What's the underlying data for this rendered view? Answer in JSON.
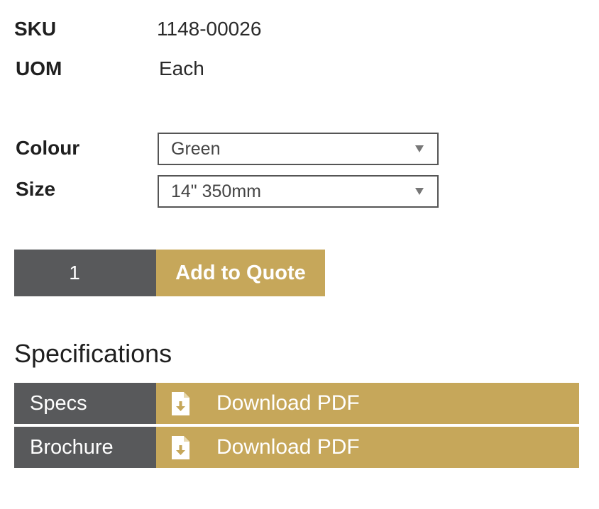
{
  "product": {
    "sku_label": "SKU",
    "sku_value": "1148-00026",
    "uom_label": "UOM",
    "uom_value": "Each"
  },
  "options": {
    "colour_label": "Colour",
    "colour_value": "Green",
    "size_label": "Size",
    "size_value": "14\" 350mm"
  },
  "quote": {
    "quantity": "1",
    "button_label": "Add to Quote"
  },
  "specifications": {
    "title": "Specifications",
    "rows": [
      {
        "label": "Specs",
        "link_label": "Download PDF"
      },
      {
        "label": "Brochure",
        "link_label": "Download PDF"
      }
    ]
  },
  "colors": {
    "accent_gold": "#c6a75a",
    "dark_grey": "#58595b"
  },
  "icons": {
    "download": "file-download-icon"
  }
}
